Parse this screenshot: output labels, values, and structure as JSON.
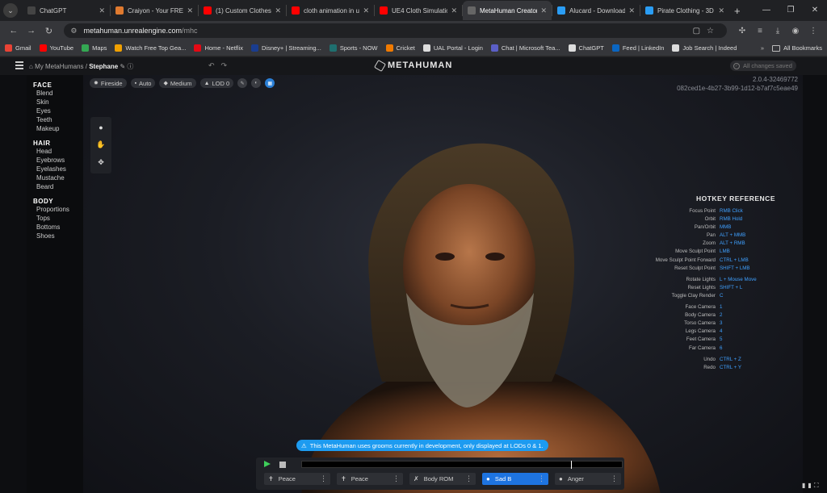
{
  "browser": {
    "tabs": [
      {
        "title": "ChatGPT",
        "icon": "chatgpt-icon",
        "color": "#444444"
      },
      {
        "title": "Craiyon - Your FREE",
        "icon": "pencil-icon",
        "color": "#e07a2f"
      },
      {
        "title": "(1) Custom Clothes f",
        "icon": "youtube-icon",
        "color": "#ff0000"
      },
      {
        "title": "cloth animation in u",
        "icon": "youtube-icon",
        "color": "#ff0000"
      },
      {
        "title": "UE4 Cloth Simulatio",
        "icon": "youtube-icon",
        "color": "#ff0000"
      },
      {
        "title": "MetaHuman Creator",
        "icon": "metahuman-icon",
        "color": "#666666"
      },
      {
        "title": "Alucard - Download",
        "icon": "globe-icon",
        "color": "#2a9df4"
      },
      {
        "title": "Pirate Clothing - 3D",
        "icon": "globe-icon",
        "color": "#2a9df4"
      }
    ],
    "url_host": "metahuman.unrealengine.com",
    "url_path": "/mhc",
    "bookmarks": [
      {
        "label": "Gmail",
        "color": "#ea4335"
      },
      {
        "label": "YouTube",
        "color": "#ff0000"
      },
      {
        "label": "Maps",
        "color": "#34a853"
      },
      {
        "label": "Watch Free Top Gea...",
        "color": "#f0a000"
      },
      {
        "label": "Home - Netflix",
        "color": "#e50914"
      },
      {
        "label": "Disney+ | Streaming...",
        "color": "#1a3d8f"
      },
      {
        "label": "Sports - NOW",
        "color": "#1f6f6f"
      },
      {
        "label": "Cricket",
        "color": "#f07a00"
      },
      {
        "label": "UAL Portal - Login",
        "color": "#dddddd"
      },
      {
        "label": "Chat | Microsoft Tea...",
        "color": "#5b5fc7"
      },
      {
        "label": "ChatGPT",
        "color": "#dddddd"
      },
      {
        "label": "Feed | LinkedIn",
        "color": "#0a66c2"
      },
      {
        "label": "Job Search | Indeed",
        "color": "#dddddd"
      }
    ],
    "all_bookmarks": "All Bookmarks"
  },
  "app": {
    "breadcrumb_parent": "My MetaHumans",
    "breadcrumb_sep": " / ",
    "character_name": "Stephane",
    "logo": "METAHUMAN",
    "saved_status": "All changes saved",
    "version": "2.0.4-32469772",
    "session_id": "082ced1e-4b27-3b99-1d12-b7af7c5eae49"
  },
  "sidebar": [
    {
      "group": "FACE",
      "items": [
        "Blend",
        "Skin",
        "Eyes",
        "Teeth",
        "Makeup"
      ]
    },
    {
      "group": "HAIR",
      "items": [
        "Head",
        "Eyebrows",
        "Eyelashes",
        "Mustache",
        "Beard"
      ]
    },
    {
      "group": "BODY",
      "items": [
        "Proportions",
        "Tops",
        "Bottoms",
        "Shoes"
      ]
    }
  ],
  "viewport": {
    "lighting": "Fireside",
    "camera": "Auto",
    "quality": "Medium",
    "lod": "LOD 0"
  },
  "hotkeys": {
    "title": "HOTKEY REFERENCE",
    "groups": [
      [
        {
          "name": "Focus Point",
          "key": "RMB Click"
        },
        {
          "name": "Orbit",
          "key": "RMB Hold"
        },
        {
          "name": "Pan/Orbit",
          "key": "MMB"
        },
        {
          "name": "Pan",
          "key": "ALT + MMB"
        },
        {
          "name": "Zoom",
          "key": "ALT + RMB"
        },
        {
          "name": "Move Sculpt Point",
          "key": "LMB"
        },
        {
          "name": "Move Sculpt Point Forward",
          "key": "CTRL + LMB"
        },
        {
          "name": "Reset Sculpt Point",
          "key": "SHIFT + LMB"
        }
      ],
      [
        {
          "name": "Rotate Lights",
          "key": "L + Mouse Move"
        },
        {
          "name": "Reset Lights",
          "key": "SHIFT + L"
        },
        {
          "name": "Toggle Clay Render",
          "key": "C"
        }
      ],
      [
        {
          "name": "Face Camera",
          "key": "1"
        },
        {
          "name": "Body Camera",
          "key": "2"
        },
        {
          "name": "Torso Camera",
          "key": "3"
        },
        {
          "name": "Legs Camera",
          "key": "4"
        },
        {
          "name": "Feet Camera",
          "key": "5"
        },
        {
          "name": "Far Camera",
          "key": "6"
        }
      ],
      [
        {
          "name": "Undo",
          "key": "CTRL + Z"
        },
        {
          "name": "Redo",
          "key": "CTRL + Y"
        }
      ]
    ]
  },
  "notice": "This MetaHuman uses grooms currently in development, only displayed at LODs 0 & 1.",
  "player": {
    "timeline_progress": 0.84,
    "poses": [
      {
        "label": "Peace",
        "icon": "standing-figure-icon",
        "active": false
      },
      {
        "label": "Peace",
        "icon": "standing-figure-icon",
        "active": false
      },
      {
        "label": "Body ROM",
        "icon": "running-figure-icon",
        "active": false
      },
      {
        "label": "Sad B",
        "icon": "face-icon",
        "active": true
      },
      {
        "label": "Anger",
        "icon": "face-icon",
        "active": false
      }
    ]
  },
  "colors": {
    "accent": "#1e74e0",
    "hotkey_key": "#3fa0ff",
    "play": "#3ecf5a",
    "notice": "#1d9bf0"
  }
}
